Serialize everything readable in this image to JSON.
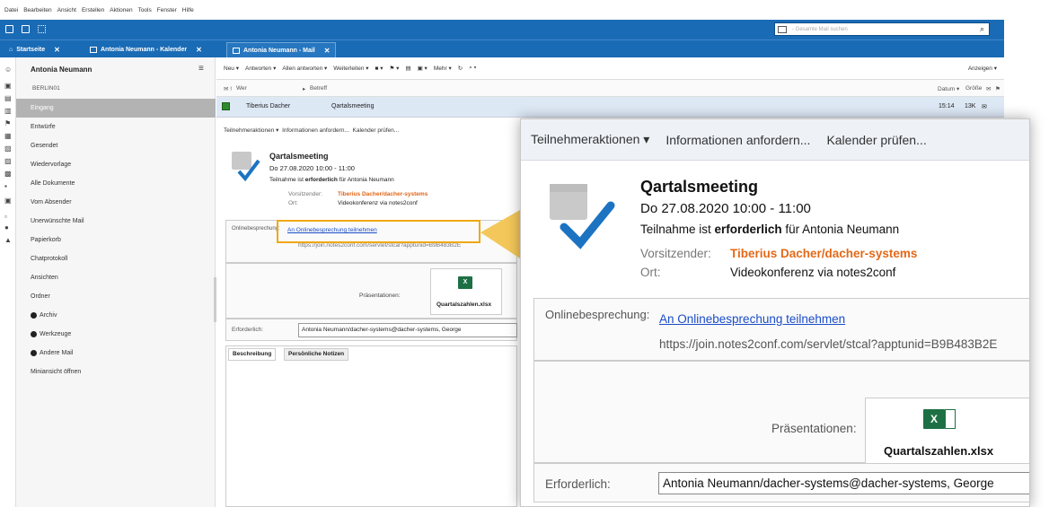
{
  "menu": [
    "Datei",
    "Bearbeiten",
    "Ansicht",
    "Erstellen",
    "Aktionen",
    "Tools",
    "Fenster",
    "Hilfe"
  ],
  "search": {
    "placeholder": "- Gesamte Mail suchen"
  },
  "tabs": [
    {
      "label": "Startseite"
    },
    {
      "label": "Antonia Neumann - Kalender"
    },
    {
      "label": "Antonia Neumann - Mail"
    }
  ],
  "nav": {
    "owner": "Antonia Neumann",
    "server": "BERLIN01",
    "items": [
      {
        "label": "Eingang"
      },
      {
        "label": "Entwürfe"
      },
      {
        "label": "Gesendet"
      },
      {
        "label": "Wiedervorlage"
      },
      {
        "label": "Alle Dokumente"
      },
      {
        "label": "Vom Absender"
      },
      {
        "label": "Unerwünschte Mail"
      },
      {
        "label": "Papierkorb"
      },
      {
        "label": "Chatprotokoll"
      },
      {
        "label": "Ansichten"
      },
      {
        "label": "Ordner"
      },
      {
        "label": "Archiv"
      },
      {
        "label": "Werkzeuge"
      },
      {
        "label": "Andere Mail"
      },
      {
        "label": "Miniansicht öffnen"
      }
    ]
  },
  "toolbar": {
    "neu": "Neu",
    "antworten": "Antworten",
    "allen": "Allen antworten",
    "weiterleiten": "Weiterleiten",
    "mehr": "Mehr",
    "anzeigen": "Anzeigen"
  },
  "columns": {
    "wer": "Wer",
    "betreff": "Betreff",
    "datum": "Datum",
    "groesse": "Größe"
  },
  "mail": {
    "from": "Tiberius Dacher",
    "subject": "Qartalsmeeting",
    "time": "15:14",
    "size": "13K"
  },
  "meeting": {
    "actions": [
      "Teilnehmeraktionen",
      "Informationen anfordern...",
      "Kalender prüfen..."
    ],
    "actions_small": [
      "Teilnehmeraktionen",
      "Informationen anfordern...",
      "Kalender prüfen..."
    ],
    "title": "Qartalsmeeting",
    "date": "Do 27.08.2020 10:00 - 11:00",
    "req_prefix": "Teilnahme ist ",
    "req_bold": "erforderlich",
    "req_suffix": " für Antonia Neumann",
    "chair_label": "Vorsitzender:",
    "chair": "Tiberius Dacher/dacher-systems",
    "place_label": "Ort:",
    "place": "Videokonferenz via notes2conf",
    "online_label": "Onlinebesprechung:",
    "online_link": "An Onlinebesprechung teilnehmen",
    "online_url": "https://join.notes2conf.com/servlet/stcal?apptunid=B9B483B2E",
    "pres_label": "Präsentationen:",
    "pres_file": "Quartalszahlen.xlsx",
    "required_label": "Erforderlich:",
    "required_value": "Antonia Neumann/dacher-systems@dacher-systems, George",
    "tab_desc": "Beschreibung",
    "tab_notes": "Persönliche Notizen"
  },
  "colors": {
    "accent": "#1a6bb5",
    "highlight": "#f0a814",
    "chair": "#e46918",
    "excel": "#1d7044"
  }
}
